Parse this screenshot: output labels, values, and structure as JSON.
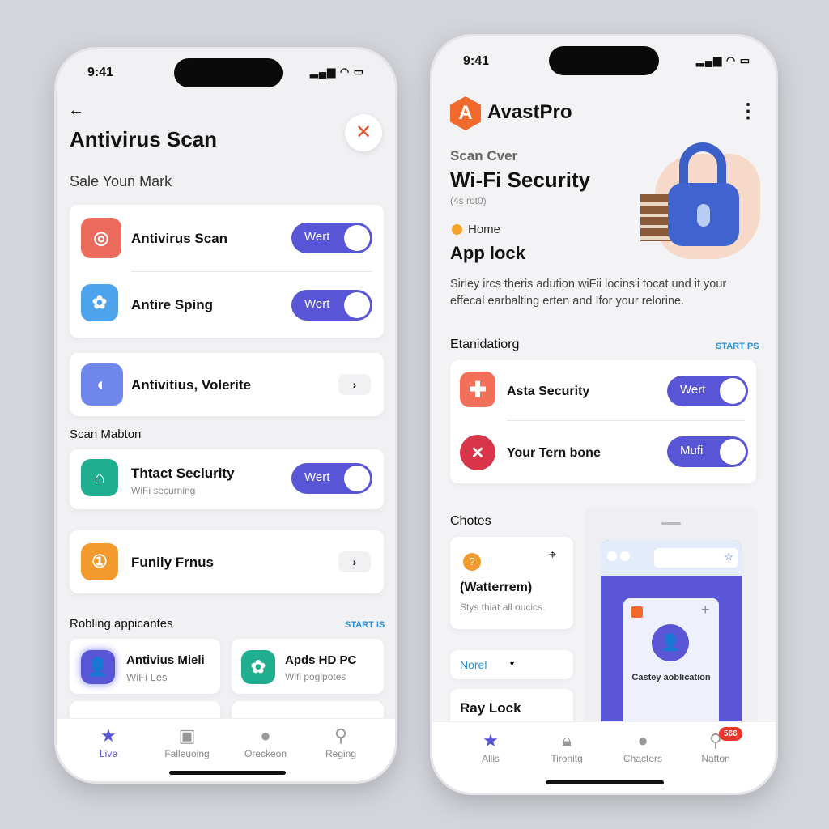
{
  "left": {
    "status": {
      "time": "9:41",
      "icons": "signal wifi battery"
    },
    "back_icon": "←",
    "close_icon": "✕",
    "title": "Antivirus Scan",
    "subtitle": "Sale Youn Mark",
    "group1": [
      {
        "label": "Antivirus Scan",
        "icon": "camera-icon",
        "toggle": "Wert"
      },
      {
        "label": "Antire Sping",
        "icon": "app-icon",
        "toggle": "Wert"
      }
    ],
    "row_antivirus": {
      "label": "Antivitius, Volerite"
    },
    "section_scan": "Scan Mabton",
    "security_item": {
      "label": "Thtact Seclurity",
      "sub": "WiFi securning",
      "toggle": "Wert"
    },
    "family_item": {
      "label": "Funily Frnus"
    },
    "section_apps": "Robling appicantes",
    "section_apps_link": "START IS",
    "apps": [
      {
        "label": "Antivius Mieli",
        "sub": "WiFi Les"
      },
      {
        "label": "Apds HD PC",
        "sub": "Wifi poglpotes"
      }
    ],
    "nav": [
      {
        "label": "Live",
        "active": true
      },
      {
        "label": "Falleuoing"
      },
      {
        "label": "Oreckeon"
      },
      {
        "label": "Reging"
      }
    ]
  },
  "right": {
    "status": {
      "time": "9:41",
      "icons": "signal wifi battery"
    },
    "brand": "AvastPro",
    "brand_letter": "A",
    "brand_color": "#f26a2b",
    "menu_icon": "⋮",
    "eyebrow": "Scan Cver",
    "heading": "Wi-Fi Security",
    "meta": "(4s rot0)",
    "home_label": "Home",
    "app_lock": "App lock",
    "description": "Sirley ircs theris adution wiFii locins'i tocat und it your effecal earbalting erten and Ifor your relorine.",
    "section_title": "Etanidatiorg",
    "section_link": "START PS",
    "items": [
      {
        "label": "Asta Security",
        "toggle": "Wert"
      },
      {
        "label": "Your Tern bone",
        "toggle": "Mufi"
      }
    ],
    "choices_title": "Chotes",
    "watter": {
      "title": "(Watterrem)",
      "sub": "Stys thiat all oucics."
    },
    "dropdown": "Norel",
    "ray_lock": "Ray Lock",
    "preview_caption": "Castey aoblication",
    "nav": [
      {
        "label": "Allis",
        "active": true
      },
      {
        "label": "Tironitg"
      },
      {
        "label": "Chacters"
      },
      {
        "label": "Natton",
        "badge": "566"
      }
    ],
    "accent": "#5855d6"
  }
}
